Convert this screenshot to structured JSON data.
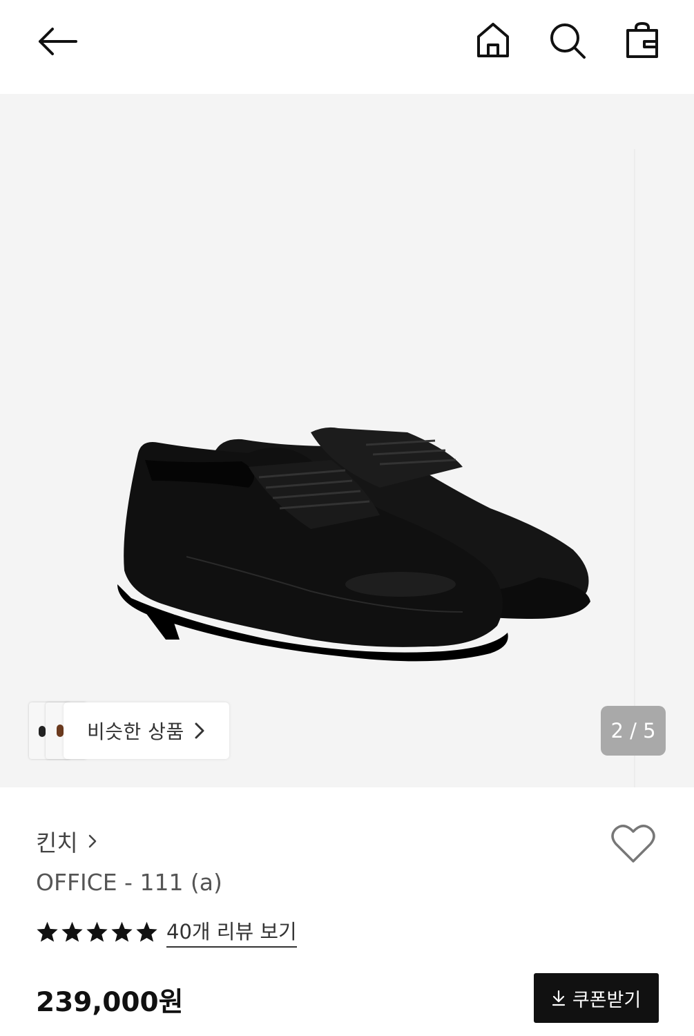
{
  "header": {
    "back_icon": "back-arrow-icon",
    "home_icon": "home-icon",
    "search_icon": "search-icon",
    "bag_icon": "shopping-bag-icon"
  },
  "gallery": {
    "image": "black-leather-derby-shoes",
    "similar_label": "비슷한 상품",
    "page_counter": "2 / 5"
  },
  "product": {
    "brand": "킨치",
    "name": "OFFICE - 111 (a)",
    "rating_stars": 5,
    "review_link": "40개 리뷰 보기",
    "price": "239,000원",
    "coupon_label": "쿠폰받기"
  },
  "colors": {
    "accent": "#111111",
    "gallery_bg": "#f4f4f4",
    "counter_bg": "#a9a9a9"
  }
}
